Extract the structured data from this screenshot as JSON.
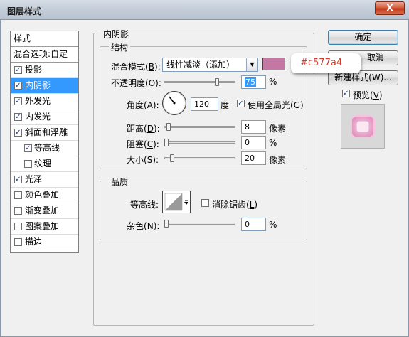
{
  "window": {
    "title": "图层样式",
    "close_label": "X"
  },
  "styles_list": {
    "header": "样式",
    "blend_options": "混合选项:自定",
    "items": [
      {
        "label": "投影",
        "checked": true,
        "selected": false,
        "sub": false
      },
      {
        "label": "内阴影",
        "checked": true,
        "selected": true,
        "sub": false
      },
      {
        "label": "外发光",
        "checked": true,
        "selected": false,
        "sub": false
      },
      {
        "label": "内发光",
        "checked": true,
        "selected": false,
        "sub": false
      },
      {
        "label": "斜面和浮雕",
        "checked": true,
        "selected": false,
        "sub": false
      },
      {
        "label": "等高线",
        "checked": true,
        "selected": false,
        "sub": true
      },
      {
        "label": "纹理",
        "checked": false,
        "selected": false,
        "sub": true
      },
      {
        "label": "光泽",
        "checked": true,
        "selected": false,
        "sub": false
      },
      {
        "label": "颜色叠加",
        "checked": false,
        "selected": false,
        "sub": false
      },
      {
        "label": "渐变叠加",
        "checked": false,
        "selected": false,
        "sub": false
      },
      {
        "label": "图案叠加",
        "checked": false,
        "selected": false,
        "sub": false
      },
      {
        "label": "描边",
        "checked": false,
        "selected": false,
        "sub": false
      }
    ]
  },
  "inner_shadow": {
    "title": "内阴影",
    "structure": {
      "title": "结构",
      "blend_mode": {
        "label": "混合模式",
        "key": "B",
        "value": "线性减淡（添加）"
      },
      "color": "#c577a4",
      "opacity": {
        "label": "不透明度",
        "key": "O",
        "value": "75",
        "unit": "%",
        "fraction": 0.75
      },
      "angle": {
        "label": "角度",
        "key": "A",
        "value": "120",
        "unit": "度",
        "global_light": {
          "label": "使用全局光",
          "key": "G",
          "checked": true
        }
      },
      "distance": {
        "label": "距离",
        "key": "D",
        "value": "8",
        "unit": "像素",
        "fraction": 0.03
      },
      "choke": {
        "label": "阻塞",
        "key": "C",
        "value": "0",
        "unit": "%",
        "fraction": 0
      },
      "size": {
        "label": "大小",
        "key": "S",
        "value": "20",
        "unit": "像素",
        "fraction": 0.08
      }
    },
    "quality": {
      "title": "品质",
      "contour": {
        "label": "等高线:",
        "anti_alias": {
          "label": "消除锯齿",
          "key": "L",
          "checked": false
        }
      },
      "noise": {
        "label": "杂色",
        "key": "N",
        "value": "0",
        "unit": "%",
        "fraction": 0
      }
    }
  },
  "buttons": {
    "ok": "确定",
    "cancel_tail": "取消",
    "new_style": "新建样式(W)...",
    "preview": {
      "label": "预览",
      "key": "V",
      "checked": true
    }
  },
  "tooltip": {
    "text": "#c577a4"
  },
  "colors": {
    "selection": "#3399ff",
    "swatch": "#c577a4",
    "tooltip_text": "#d23a2c"
  }
}
